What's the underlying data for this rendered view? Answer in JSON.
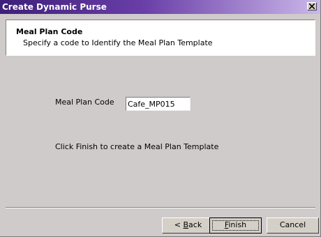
{
  "window": {
    "title": "Create Dynamic Purse"
  },
  "header": {
    "title": "Meal Plan Code",
    "subtitle": "Specify a code to Identify the Meal Plan Template"
  },
  "form": {
    "meal_plan_code_label": "Meal Plan Code",
    "meal_plan_code_value": "Cafe_MP015",
    "instruction": "Click Finish to create a Meal Plan Template"
  },
  "buttons": {
    "back_prefix": "< ",
    "back_mnemonic": "B",
    "back_rest": "ack",
    "finish_mnemonic": "F",
    "finish_rest": "inish",
    "cancel": "Cancel"
  },
  "icons": {
    "close": "close-icon"
  },
  "colors": {
    "titlebar_start": "#3d1f7a",
    "titlebar_end": "#cbb7ea",
    "dialog_background": "#cfcbca",
    "header_background": "#ffffff"
  }
}
